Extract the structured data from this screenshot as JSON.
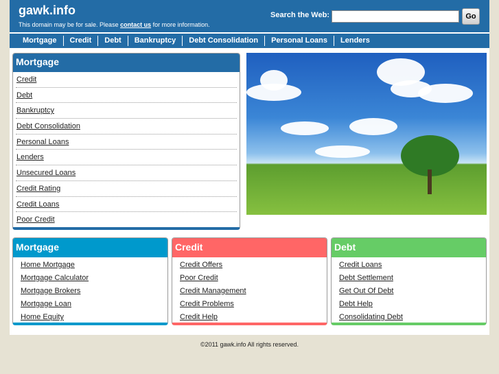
{
  "header": {
    "title": "gawk.info",
    "tagline_before": "This domain may be for sale. Please ",
    "tagline_link": "contact us",
    "tagline_after": " for more information.",
    "search_label": "Search the Web:",
    "search_value": "",
    "go_label": "Go"
  },
  "nav": [
    "Mortgage",
    "Credit",
    "Debt",
    "Bankruptcy",
    "Debt Consolidation",
    "Personal Loans",
    "Lenders"
  ],
  "left_box": {
    "title": "Mortgage",
    "items": [
      "Credit",
      "Debt",
      "Bankruptcy",
      "Debt Consolidation",
      "Personal Loans",
      "Lenders",
      "Unsecured Loans",
      "Credit Rating",
      "Credit Loans",
      "Poor Credit"
    ]
  },
  "boxes": [
    {
      "title": "Mortgage",
      "color": "#0099cc",
      "items": [
        "Home Mortgage",
        "Mortgage Calculator",
        "Mortgage Brokers",
        "Mortgage Loan",
        "Home Equity"
      ]
    },
    {
      "title": "Credit",
      "color": "#ff6666",
      "items": [
        "Credit Offers",
        "Poor Credit",
        "Credit Management",
        "Credit Problems",
        "Credit Help"
      ]
    },
    {
      "title": "Debt",
      "color": "#66cc66",
      "items": [
        "Credit Loans",
        "Debt Settlement",
        "Get Out Of Debt",
        "Debt Help",
        "Consolidating Debt"
      ]
    }
  ],
  "footer": "©2011 gawk.info All rights reserved."
}
